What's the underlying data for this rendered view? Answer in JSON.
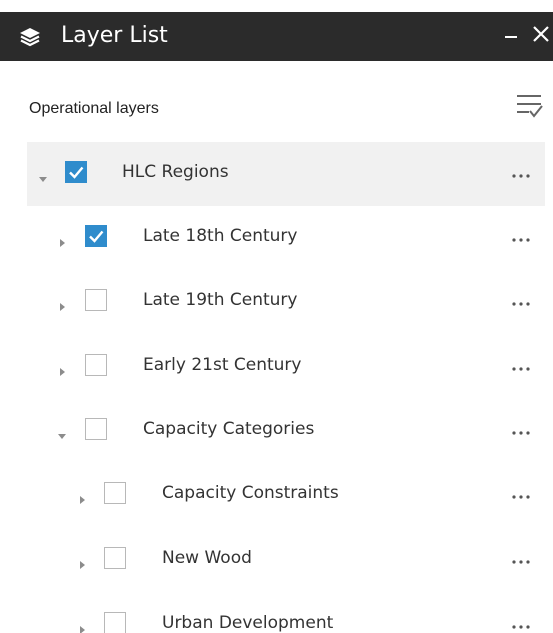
{
  "window": {
    "title": "Layer List",
    "minimize_label": "–",
    "close_label": "✕"
  },
  "header": {
    "section_label": "Operational layers",
    "options_icon": "list-options-icon"
  },
  "layers": [
    {
      "label": "HLC Regions",
      "checked": true,
      "expanded": true,
      "level": 0,
      "selected": true
    },
    {
      "label": "Late 18th Century",
      "checked": true,
      "expanded": false,
      "level": 1,
      "selected": false
    },
    {
      "label": "Late 19th Century",
      "checked": false,
      "expanded": false,
      "level": 1,
      "selected": false
    },
    {
      "label": "Early 21st Century",
      "checked": false,
      "expanded": false,
      "level": 1,
      "selected": false
    },
    {
      "label": "Capacity Categories",
      "checked": false,
      "expanded": true,
      "level": 1,
      "selected": false
    },
    {
      "label": "Capacity Constraints",
      "checked": false,
      "expanded": false,
      "level": 2,
      "selected": false
    },
    {
      "label": "New Wood",
      "checked": false,
      "expanded": false,
      "level": 2,
      "selected": false
    },
    {
      "label": "Urban Development",
      "checked": false,
      "expanded": false,
      "level": 2,
      "selected": false
    }
  ],
  "colors": {
    "titlebar": "#2b2b2b",
    "checkbox_accent": "#2f8ccc",
    "selected_row": "#f1f1f1"
  }
}
